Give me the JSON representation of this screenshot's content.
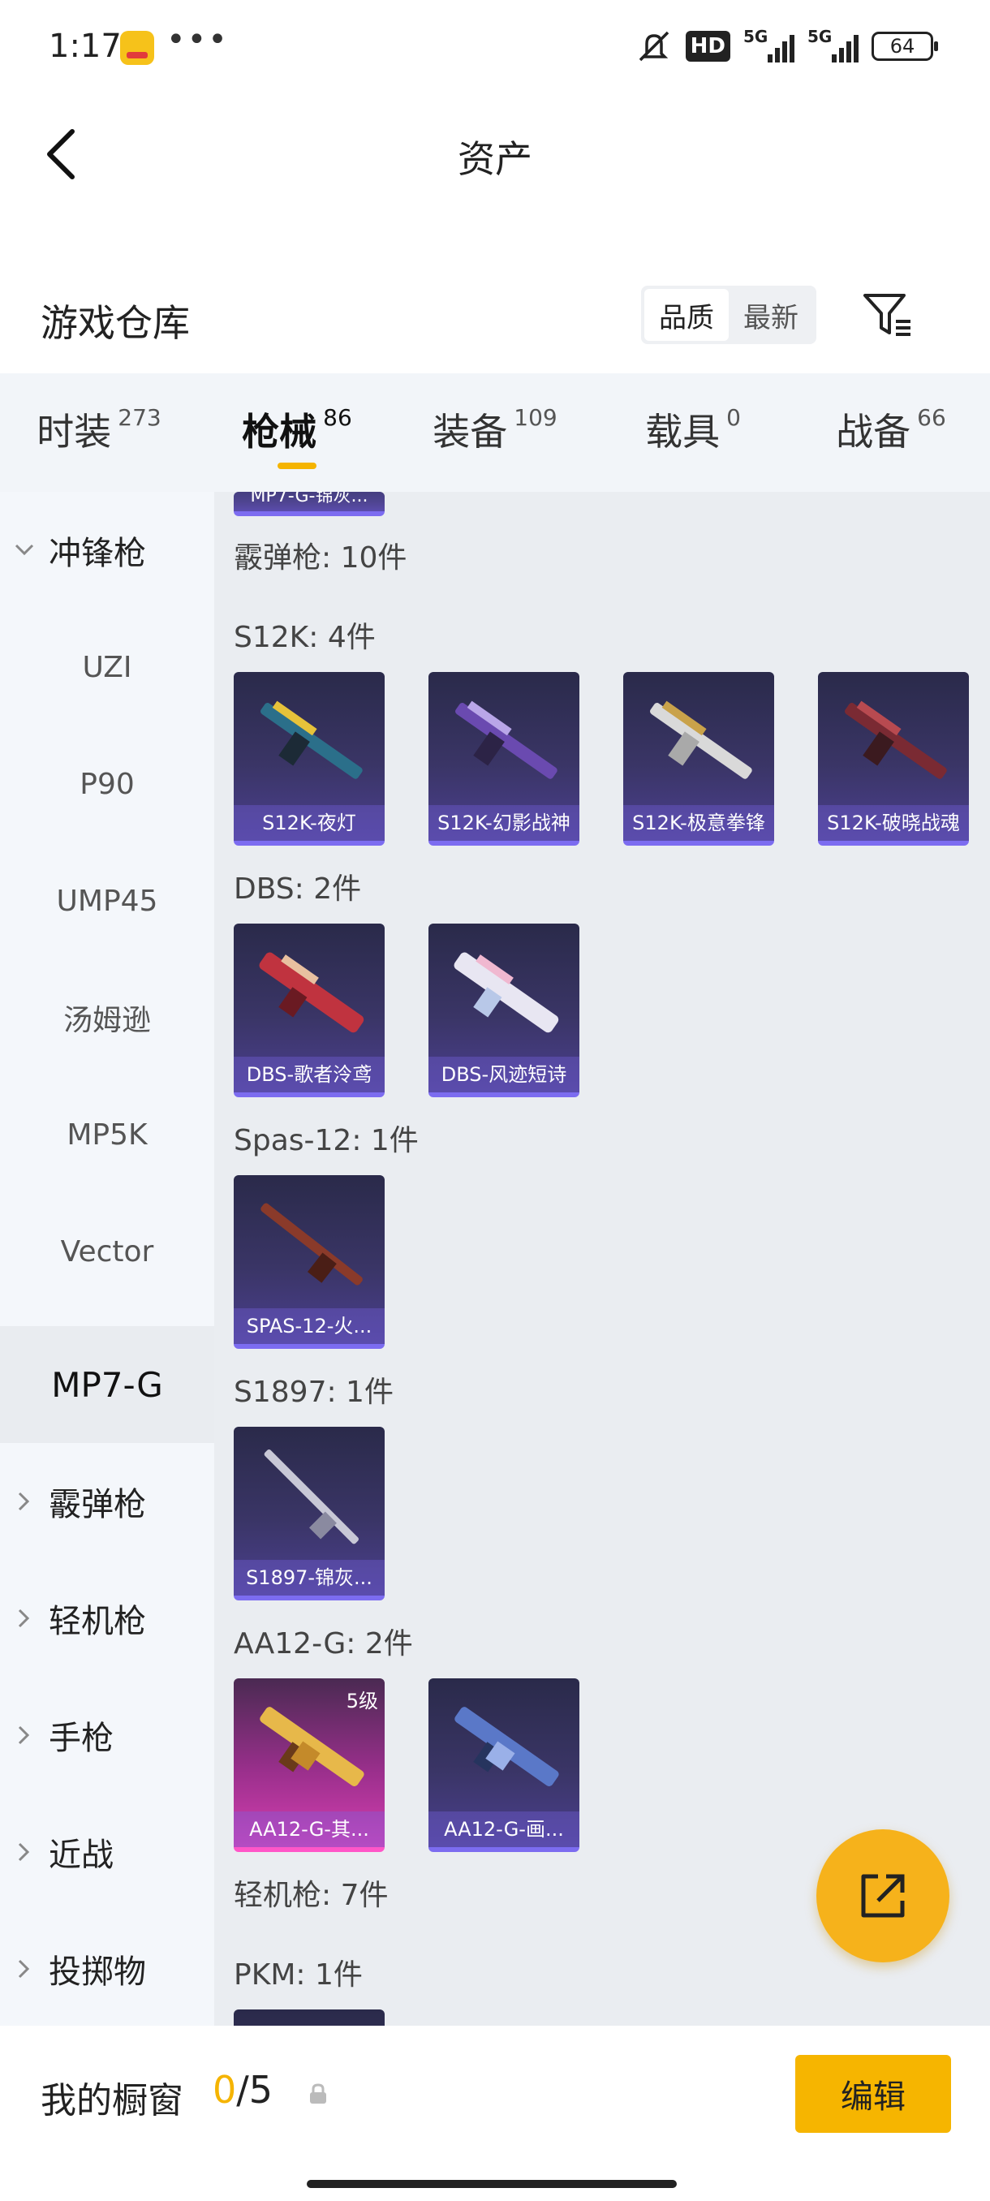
{
  "status_bar": {
    "time": "1:17",
    "dots": "•••",
    "hd": "HD",
    "signal1": "5G",
    "signal2": "5G",
    "battery": "64"
  },
  "header": {
    "title": "资产"
  },
  "warehouse": {
    "title": "游戏仓库",
    "sort_quality": "品质",
    "sort_newest": "最新"
  },
  "tabs": [
    {
      "label": "时装",
      "count": "273"
    },
    {
      "label": "枪械",
      "count": "86"
    },
    {
      "label": "装备",
      "count": "109"
    },
    {
      "label": "载具",
      "count": "0"
    },
    {
      "label": "战备",
      "count": "66"
    }
  ],
  "sidebar": {
    "smg": "冲锋枪",
    "uzi": "UZI",
    "p90": "P90",
    "ump45": "UMP45",
    "thompson": "汤姆逊",
    "mp5k": "MP5K",
    "vector": "Vector",
    "mp7g": "MP7-G",
    "shotgun": "霰弹枪",
    "lmg": "轻机枪",
    "pistol": "手枪",
    "melee": "近战",
    "throwable": "投掷物"
  },
  "content": {
    "partial_top": "MP7-G-锦灰...",
    "shotgun_header": "霰弹枪: 10件",
    "s12k": {
      "label": "S12K: 4件",
      "items": [
        "S12K-夜灯",
        "S12K-幻影战神",
        "S12K-极意拳锋",
        "S12K-破晓战魂"
      ]
    },
    "dbs": {
      "label": "DBS: 2件",
      "items": [
        "DBS-歌者泠鸢",
        "DBS-风迹短诗"
      ]
    },
    "spas": {
      "label": "Spas-12: 1件",
      "items": [
        "SPAS-12-火..."
      ]
    },
    "s1897": {
      "label": "S1897: 1件",
      "items": [
        "S1897-锦灰..."
      ]
    },
    "aa12": {
      "label": "AA12-G: 2件",
      "items": [
        "AA12-G-其...",
        "AA12-G-画..."
      ],
      "level": "5级"
    },
    "lmg_header": "轻机枪: 7件",
    "pkm": {
      "label": "PKM: 1件"
    }
  },
  "bottom": {
    "title": "我的橱窗",
    "current": "0",
    "total": "/5",
    "edit_label": "编辑"
  }
}
